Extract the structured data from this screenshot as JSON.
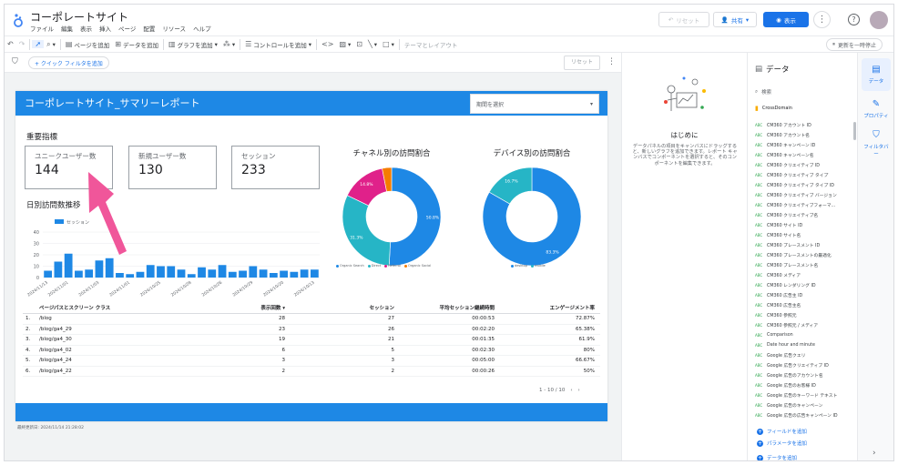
{
  "app": {
    "title": "コーポレートサイト"
  },
  "menu": [
    "ファイル",
    "編集",
    "表示",
    "挿入",
    "ページ",
    "配置",
    "リソース",
    "ヘルプ"
  ],
  "header_actions": {
    "reset": "リセット",
    "share": "共有",
    "view": "表示"
  },
  "toolbar": {
    "add_page": "ページを追加",
    "add_data": "データを追加",
    "add_chart": "グラフを追加",
    "add_control": "コントロールを追加",
    "theme_layout": "テーマとレイアウト",
    "pause_updates": "更新を一時停止"
  },
  "filterbar": {
    "quick_filter": "+ クイック フィルタを追加",
    "reset": "リセット"
  },
  "report": {
    "title": "コーポレートサイト_サマリーレポート",
    "period_placeholder": "期間を選択",
    "kpi_section": "重要指標",
    "kpis": [
      {
        "label": "ユニークユーザー数",
        "value": "144"
      },
      {
        "label": "新規ユーザー数",
        "value": "130"
      },
      {
        "label": "セッション",
        "value": "233"
      }
    ],
    "trend_title": "日別訪問数推移",
    "channel_title": "チャネル別の訪問割合",
    "device_title": "デバイス別の訪問割合",
    "updated": "最終更新日: 2024/11/14 21:28:02"
  },
  "chart_data": [
    {
      "type": "bar",
      "title": "日別訪問数推移",
      "series": [
        {
          "name": "セッション",
          "values": [
            6,
            14,
            21,
            6,
            7,
            15,
            17,
            4,
            3,
            5,
            11,
            10,
            10,
            7,
            3,
            9,
            7,
            11,
            5,
            6,
            10,
            7,
            4,
            6,
            5,
            7,
            7
          ]
        }
      ],
      "categories": [
        "2024/11/13",
        "",
        "2024/11/01",
        "",
        "",
        "2024/11/03",
        "",
        "",
        "2024/11/01",
        "",
        "",
        "2024/10/25",
        "",
        "",
        "2024/10/28",
        "",
        "",
        "2024/10/26",
        "",
        "",
        "2024/10/29",
        "",
        "",
        "2024/10/20",
        "",
        "",
        "2024/10/13"
      ],
      "ylim": [
        0,
        40
      ],
      "yticks": [
        0,
        10,
        20,
        30,
        40
      ]
    },
    {
      "type": "pie",
      "title": "チャネル別の訪問割合",
      "labels": [
        "Organic Search",
        "Direct",
        "Referral",
        "Organic Social"
      ],
      "values": [
        50.8,
        31.3,
        14.8,
        3.1
      ],
      "colors": [
        "#1e88e5",
        "#26b5c6",
        "#e0218a",
        "#f57c00"
      ]
    },
    {
      "type": "pie",
      "title": "デバイス別の訪問割合",
      "labels": [
        "desktop",
        "mobile"
      ],
      "values": [
        83.3,
        16.7
      ],
      "colors": [
        "#1e88e5",
        "#26b5c6"
      ]
    }
  ],
  "pie_value_labels": {
    "channel": [
      "50.8%",
      "31.3%",
      "14.8%"
    ],
    "device": [
      "83.3%",
      "16.7%"
    ]
  },
  "table": {
    "headers": [
      "",
      "ページパスとスクリーン クラス",
      "表示回数 ▾",
      "セッション",
      "平均セッション継続時間",
      "エンゲージメント率"
    ],
    "rows": [
      [
        "1.",
        "/blog",
        "28",
        "27",
        "00:00:53",
        "72.87%"
      ],
      [
        "2.",
        "/blog/ga4_29",
        "23",
        "26",
        "00:02:20",
        "65.38%"
      ],
      [
        "3.",
        "/blog/ga4_30",
        "19",
        "21",
        "00:01:35",
        "61.9%"
      ],
      [
        "4.",
        "/blog/ga4_02",
        "6",
        "5",
        "00:02:30",
        "80%"
      ],
      [
        "5.",
        "/blog/ga4_24",
        "3",
        "3",
        "00:05:00",
        "66.67%"
      ],
      [
        "6.",
        "/blog/ga4_22",
        "2",
        "2",
        "00:00:26",
        "50%"
      ]
    ],
    "pager": "1 - 10 / 10"
  },
  "intro": {
    "title": "はじめに",
    "text": "データパネルの項目をキャンバスにドラッグすると、新しいグラフを追加できます。レポート キャンバスでコンポーネントを選択すると、そのコンポーネントを編集できます。"
  },
  "data_panel": {
    "title": "データ",
    "search_placeholder": "検索",
    "source": "CrossDomain",
    "fields": [
      "CM360 アカウント ID",
      "CM360 アカウント名",
      "CM360 キャンペーン ID",
      "CM360 キャンペーン名",
      "CM360 クリエイティブ ID",
      "CM360 クリエイティブ タイプ",
      "CM360 クリエイティブ タイプ ID",
      "CM360 クリエイティブ バージョン",
      "CM360 クリエイティブフォーマ...",
      "CM360 クリエイティブ名",
      "CM360 サイト ID",
      "CM360 サイト名",
      "CM360 プレースメント ID",
      "CM360 プレースメントの最適化",
      "CM360 プレースメント名",
      "CM360 メディア",
      "CM360 レンダリング ID",
      "CM360 広告主 ID",
      "CM360 広告主名",
      "CM360 参照元",
      "CM360 参照元 / メディア",
      "Comparison",
      "Date hour and minute",
      "Google 広告クエリ",
      "Google 広告クリエイティブ ID",
      "Google 広告のアカウント名",
      "Google 広告のお客様 ID",
      "Google 広告のキーワード テキスト",
      "Google 広告のキャンペーン",
      "Google 広告の広告キャンペーン ID"
    ],
    "add_field": "フィールドを追加",
    "add_param": "パラメータを追加",
    "add_data": "データを追加"
  },
  "side_tabs": [
    "データ",
    "プロパティ",
    "フィルタバー"
  ]
}
